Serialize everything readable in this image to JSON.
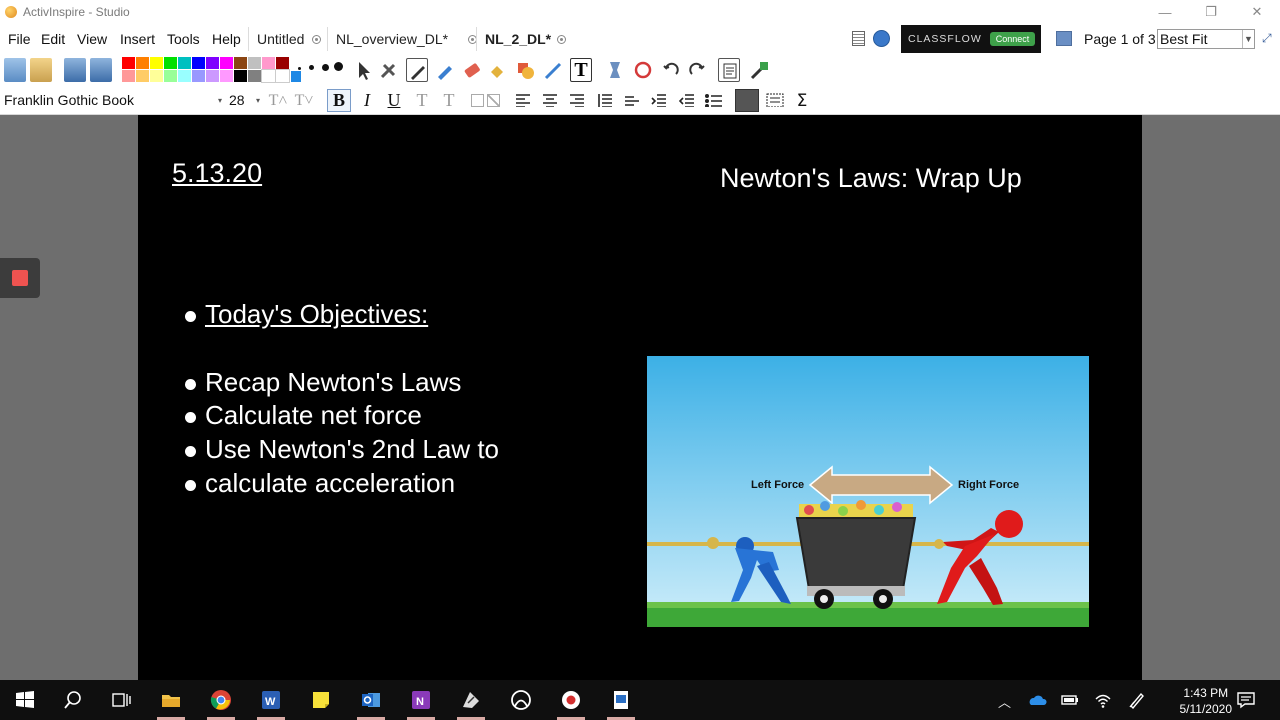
{
  "window": {
    "title": "ActivInspire - Studio"
  },
  "menu": [
    "File",
    "Edit",
    "View",
    "Insert",
    "Tools",
    "Help"
  ],
  "tabs": [
    {
      "label": "Untitled",
      "active": false
    },
    {
      "label": "NL_overview_DL*",
      "active": false
    },
    {
      "label": "NL_2_DL*",
      "active": true
    }
  ],
  "classflow": {
    "brand": "CLASSFLOW",
    "connect_label": "Connect"
  },
  "page_nav": {
    "label": "Page 1 of 3",
    "zoom": "Best Fit"
  },
  "format": {
    "font_name": "Franklin Gothic Book",
    "font_size": "28"
  },
  "slide": {
    "date": "5.13.20",
    "title": "Newton's Laws: Wrap  Up",
    "bullets": [
      "Today's Objectives:",
      "Recap Newton's Laws",
      "Calculate net force",
      "Use Newton's 2nd Law to",
      "calculate acceleration"
    ],
    "image": {
      "left_label": "Left Force",
      "right_label": "Right Force"
    }
  },
  "taskbar": {
    "time": "1:43 PM",
    "date": "5/11/2020"
  },
  "colors": {
    "accent_green": "#3ea14a",
    "stop_red": "#ef5350",
    "page_bg": "#000000",
    "workspace": "#6e6e6e"
  }
}
